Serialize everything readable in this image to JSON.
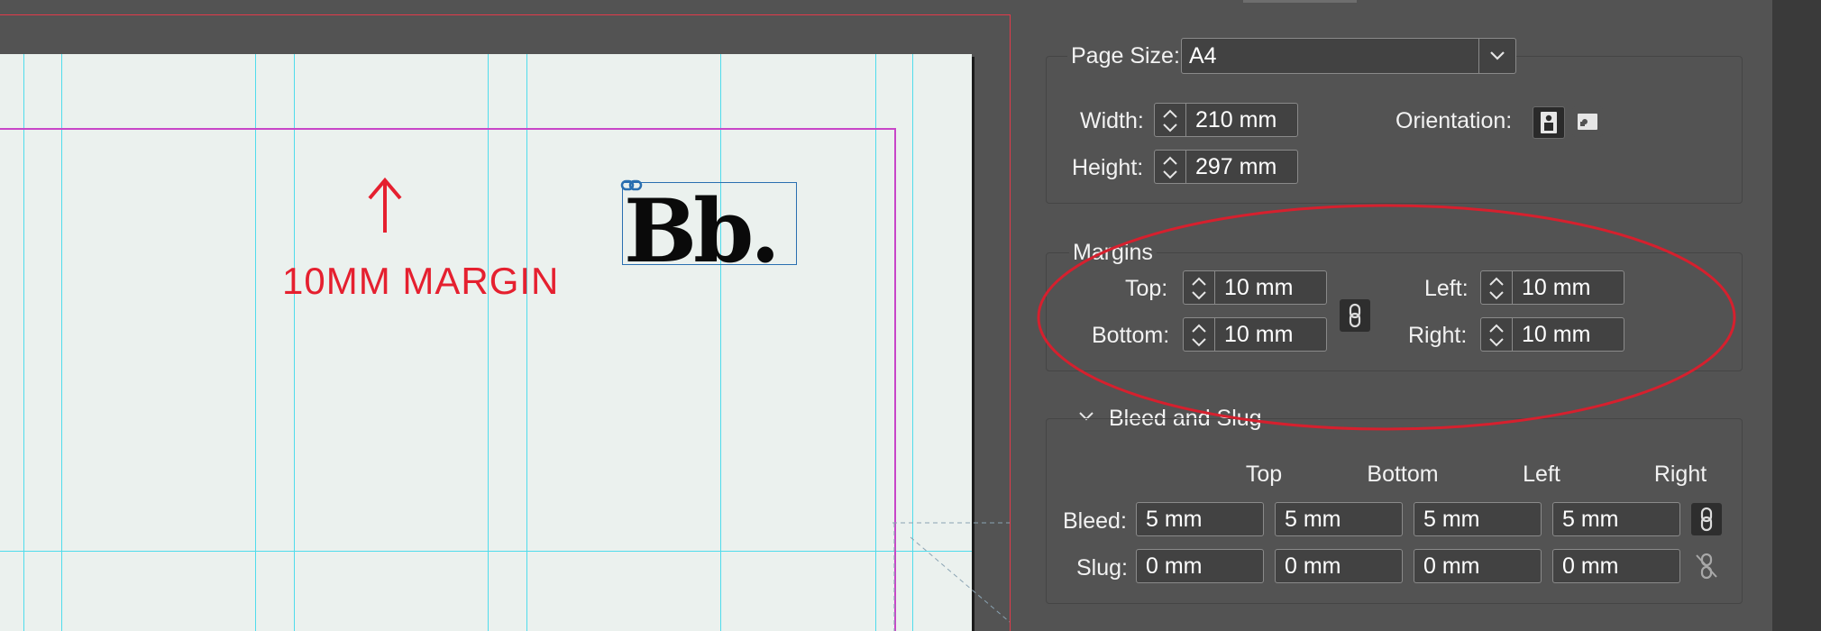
{
  "canvas": {
    "annotation": "10MM MARGIN",
    "logo_text": "Bb."
  },
  "panel": {
    "page_size": {
      "label": "Page Size:",
      "value": "A4"
    },
    "width": {
      "label": "Width:",
      "value": "210 mm"
    },
    "height": {
      "label": "Height:",
      "value": "297 mm"
    },
    "orientation": {
      "label": "Orientation:",
      "options": [
        "portrait-icon",
        "landscape-icon"
      ],
      "selected": "portrait"
    },
    "margins": {
      "title": "Margins",
      "top": {
        "label": "Top:",
        "value": "10 mm"
      },
      "bottom": {
        "label": "Bottom:",
        "value": "10 mm"
      },
      "left": {
        "label": "Left:",
        "value": "10 mm"
      },
      "right": {
        "label": "Right:",
        "value": "10 mm"
      },
      "linked": true
    },
    "bleed_slug": {
      "title": "Bleed and Slug",
      "columns": [
        "Top",
        "Bottom",
        "Left",
        "Right"
      ],
      "bleed": {
        "label": "Bleed:",
        "values": [
          "5 mm",
          "5 mm",
          "5 mm",
          "5 mm"
        ],
        "linked": true
      },
      "slug": {
        "label": "Slug:",
        "values": [
          "0 mm",
          "0 mm",
          "0 mm",
          "0 mm"
        ],
        "linked": false
      }
    }
  },
  "colors": {
    "annotation_red": "#e5202f",
    "guide_cyan": "#4fdcec",
    "margin_magenta": "#c846c8",
    "panel_bg": "#535353",
    "page_bg": "#ebf1ee"
  }
}
